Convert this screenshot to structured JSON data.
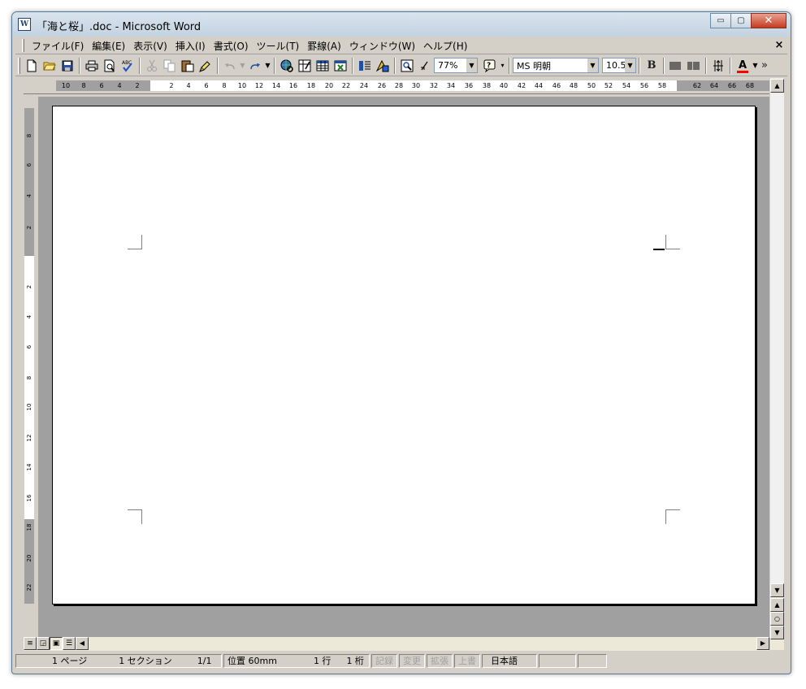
{
  "window": {
    "title": "「海と桜」.doc - Microsoft Word",
    "app_icon_glyph": "W"
  },
  "caption_buttons": {
    "minimize": "▭",
    "maximize": "▢",
    "close": "✕"
  },
  "menu": {
    "items": [
      "ファイル(F)",
      "編集(E)",
      "表示(V)",
      "挿入(I)",
      "書式(O)",
      "ツール(T)",
      "罫線(A)",
      "ウィンドウ(W)",
      "ヘルプ(H)"
    ],
    "doc_close": "×"
  },
  "toolbar": {
    "zoom": "77%",
    "font_name": "MS 明朝",
    "font_size": "10.5",
    "bold_label": "B",
    "font_color_label": "A",
    "font_color": "#ff0000",
    "more_label": "»"
  },
  "ruler": {
    "ticks": [
      "10",
      "8",
      "6",
      "4",
      "2",
      "2",
      "4",
      "6",
      "8",
      "10",
      "12",
      "14",
      "16",
      "18",
      "20",
      "22",
      "24",
      "26",
      "28",
      "30",
      "32",
      "34",
      "36",
      "38",
      "40",
      "42",
      "44",
      "46",
      "48",
      "50",
      "52",
      "54",
      "56",
      "58",
      "62",
      "64",
      "66",
      "68"
    ],
    "vticks": [
      "8",
      "6",
      "4",
      "2",
      "2",
      "4",
      "6",
      "8",
      "10",
      "12",
      "14",
      "16",
      "18",
      "20",
      "22"
    ]
  },
  "status": {
    "page": "1 ページ",
    "section": "1 セクション",
    "page_of": "1/1",
    "position": "位置 60mm",
    "line": "1 行",
    "column": "1 桁",
    "rec": "記録",
    "trk": "変更",
    "ext": "拡張",
    "ovr": "上書",
    "language": "日本語"
  }
}
